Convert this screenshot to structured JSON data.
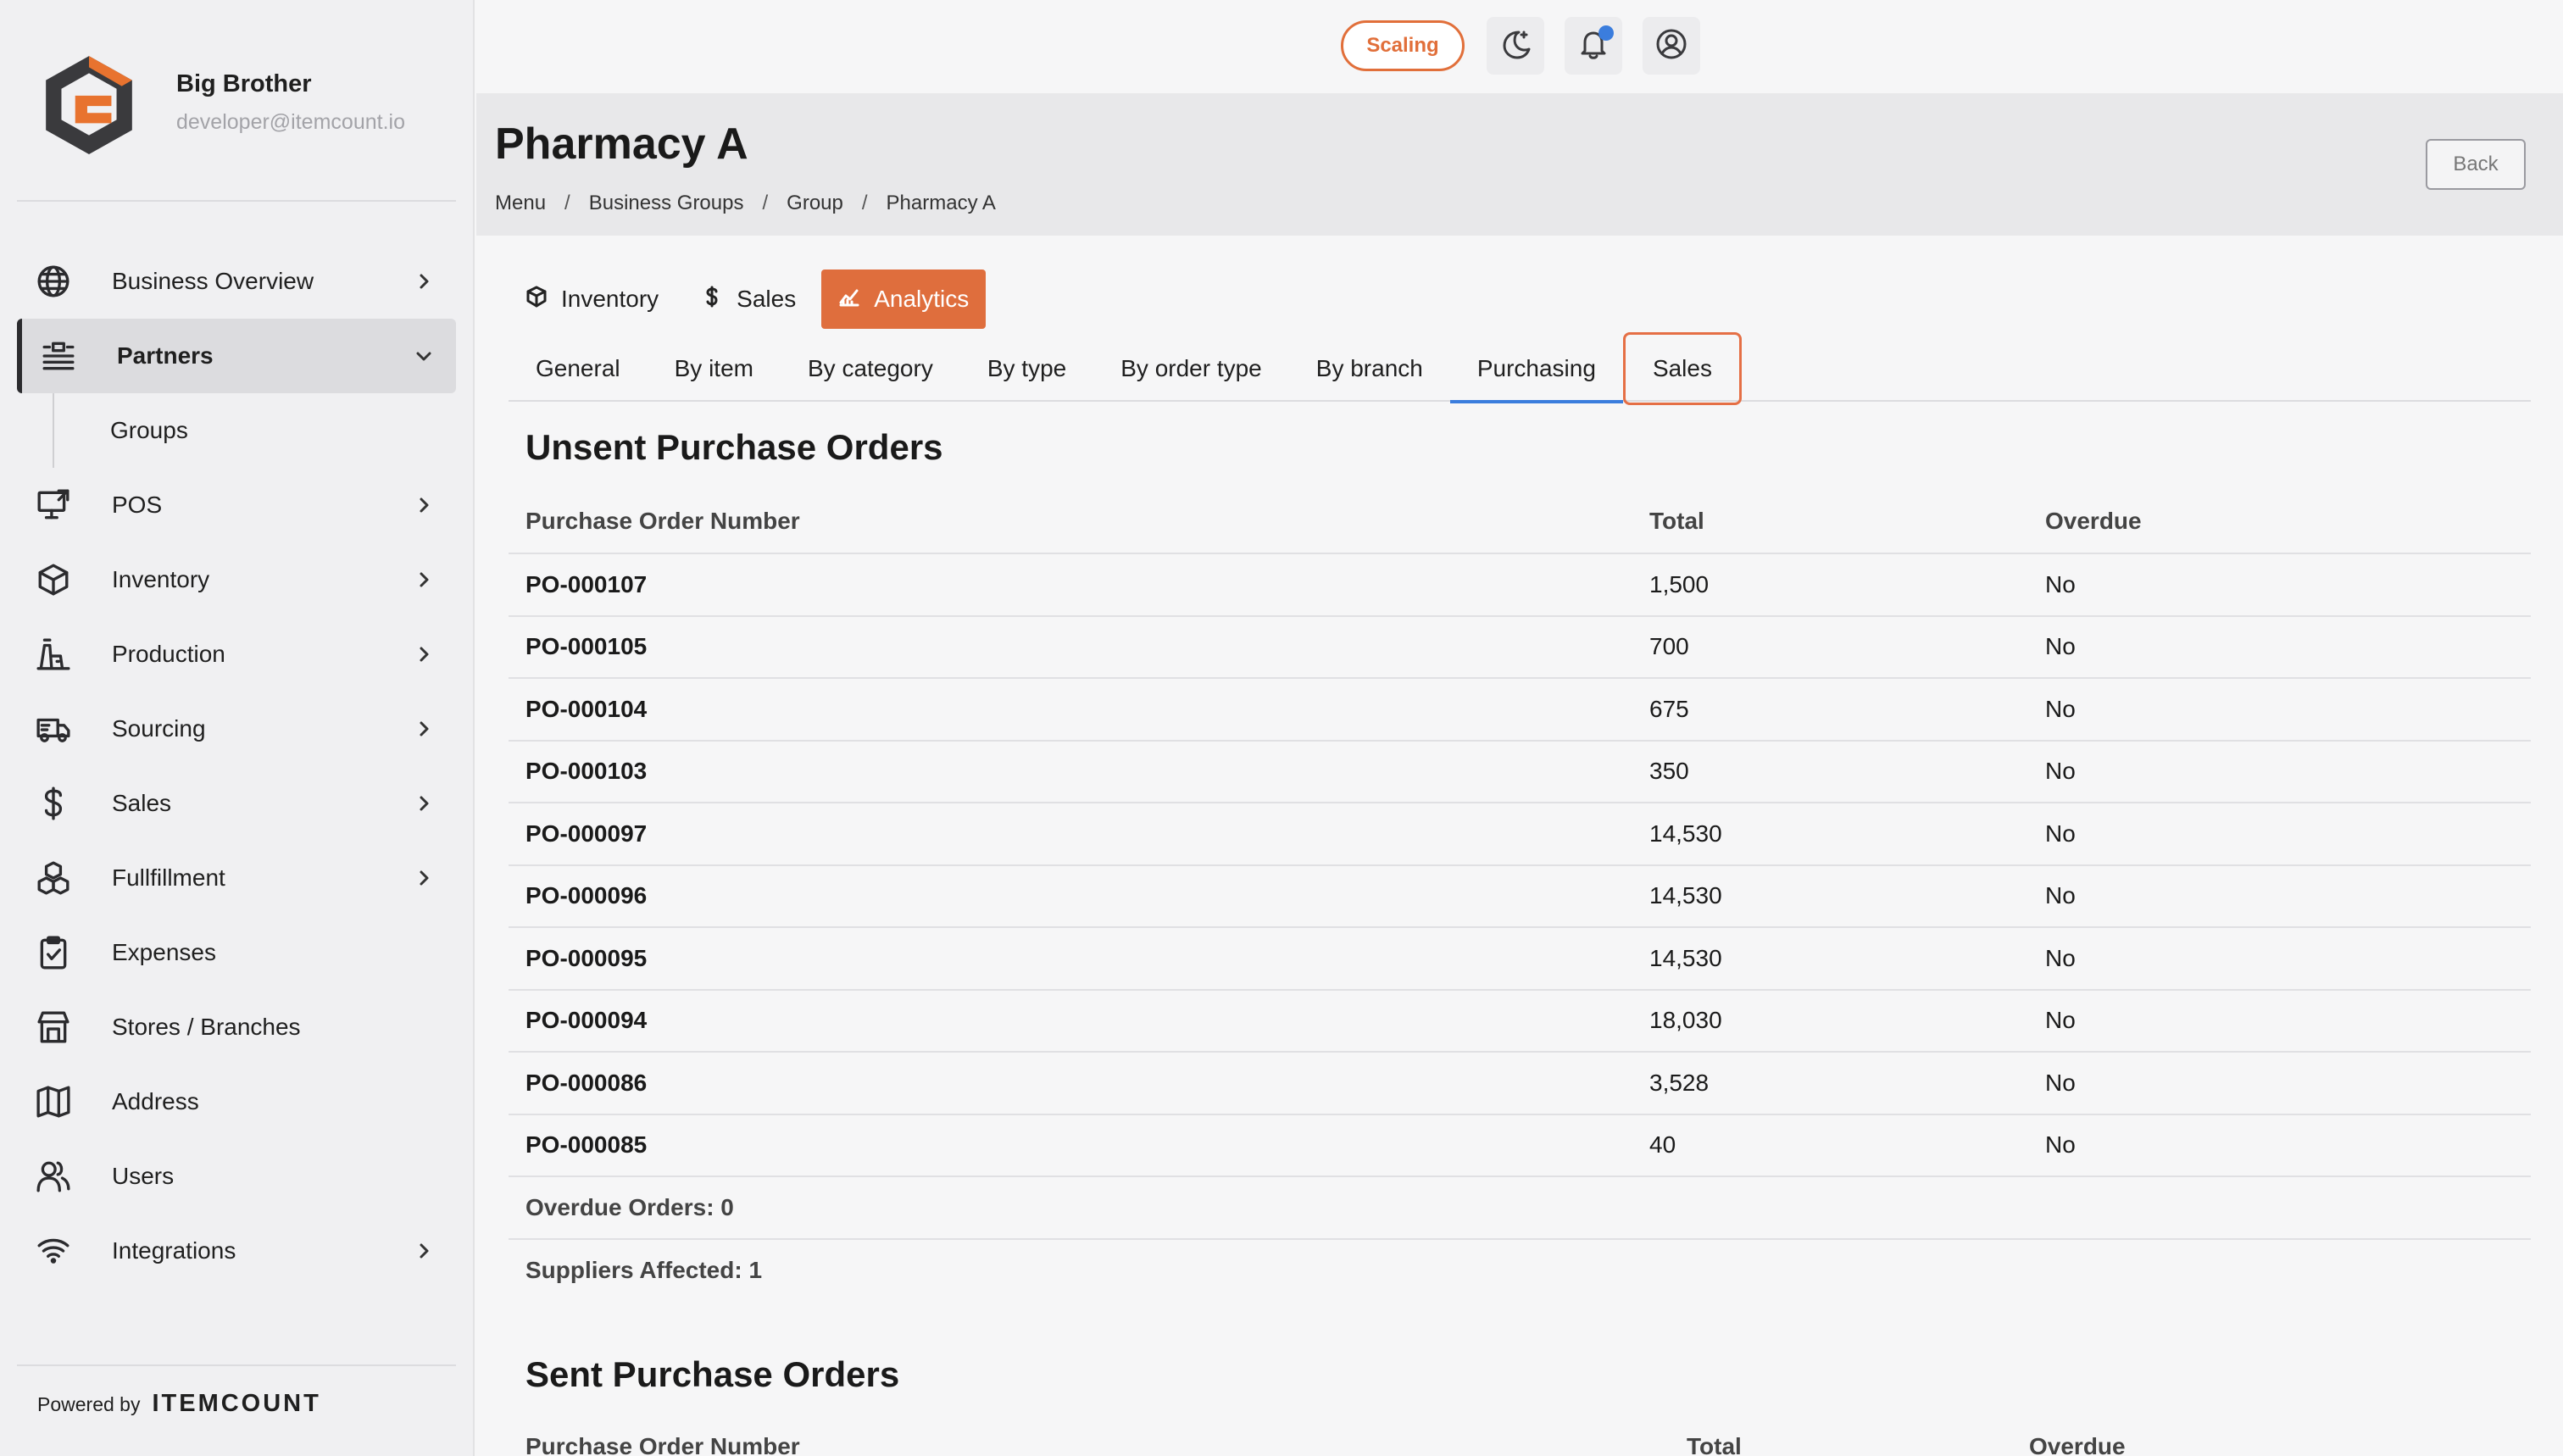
{
  "brand": {
    "name": "Big Brother",
    "email": "developer@itemcount.io"
  },
  "sidebar": {
    "items": [
      {
        "label": "Business Overview",
        "icon": "globe-icon"
      },
      {
        "label": "Partners",
        "icon": "partners-icon"
      },
      {
        "label": "POS",
        "icon": "pos-icon"
      },
      {
        "label": "Inventory",
        "icon": "box-icon"
      },
      {
        "label": "Production",
        "icon": "factory-icon"
      },
      {
        "label": "Sourcing",
        "icon": "truck-icon"
      },
      {
        "label": "Sales",
        "icon": "dollar-icon"
      },
      {
        "label": "Fullfillment",
        "icon": "boxes-icon"
      },
      {
        "label": "Expenses",
        "icon": "clipboard-icon"
      },
      {
        "label": "Stores / Branches",
        "icon": "store-icon"
      },
      {
        "label": "Address",
        "icon": "map-icon"
      },
      {
        "label": "Users",
        "icon": "users-icon"
      },
      {
        "label": "Integrations",
        "icon": "wifi-icon"
      }
    ],
    "sub_items": [
      {
        "label": "Groups"
      }
    ],
    "powered_by": "Powered by",
    "powered_brand": "ITEMCOUNT"
  },
  "topbar": {
    "scaling_label": "Scaling"
  },
  "header": {
    "title": "Pharmacy A",
    "breadcrumb": [
      "Menu",
      "Business Groups",
      "Group",
      "Pharmacy A"
    ],
    "back_label": "Back"
  },
  "modules": [
    {
      "label": "Inventory",
      "icon": "box-icon"
    },
    {
      "label": "Sales",
      "icon": "dollar-icon"
    },
    {
      "label": "Analytics",
      "icon": "chart-icon"
    }
  ],
  "tabs": [
    "General",
    "By item",
    "By category",
    "By type",
    "By order type",
    "By branch",
    "Purchasing",
    "Sales"
  ],
  "unsent": {
    "title": "Unsent Purchase Orders",
    "columns": [
      "Purchase Order Number",
      "Total",
      "Overdue"
    ],
    "rows": [
      [
        "PO-000107",
        "1,500",
        "No"
      ],
      [
        "PO-000105",
        "700",
        "No"
      ],
      [
        "PO-000104",
        "675",
        "No"
      ],
      [
        "PO-000103",
        "350",
        "No"
      ],
      [
        "PO-000097",
        "14,530",
        "No"
      ],
      [
        "PO-000096",
        "14,530",
        "No"
      ],
      [
        "PO-000095",
        "14,530",
        "No"
      ],
      [
        "PO-000094",
        "18,030",
        "No"
      ],
      [
        "PO-000086",
        "3,528",
        "No"
      ],
      [
        "PO-000085",
        "40",
        "No"
      ]
    ],
    "overdue_orders": "Overdue Orders: 0",
    "suppliers_affected": "Suppliers Affected: 1"
  },
  "sent": {
    "title": "Sent Purchase Orders",
    "columns": [
      "Purchase Order Number",
      "Total",
      "Overdue"
    ]
  },
  "colors": {
    "accent": "#df6e3d",
    "active_tab": "#3b7ddd",
    "notification": "#3b7ddd"
  }
}
